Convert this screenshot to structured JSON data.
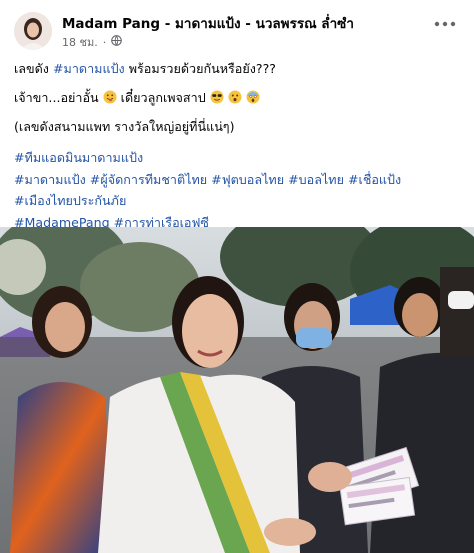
{
  "post": {
    "author": "Madam Pang - มาดามแป้ง - นวลพรรณ ล่ำซำ",
    "time": "18 ชม.",
    "privacy_icon": "globe-icon",
    "more_icon": "more-options-icon",
    "caption": {
      "line1_pre": "เลขดัง ",
      "line1_tag": "#มาดามแป้ง",
      "line1_post": " พร้อมรวยด้วยกันหรือยัง???",
      "line2_text": "เจ้าขา...อย่าอั้น",
      "line2_mid": "เดี๋ยวลูกเพจสาป",
      "line3": "(เลขดังสนามแพท รางวัลใหญ่อยู่ที่นี่แน่ๆ)"
    },
    "hashtags": [
      [
        "#ทีมแอดมินมาดามแป้ง"
      ],
      [
        "#มาดามแป้ง",
        "#ผู้จัดการทีมชาติไทย",
        "#ฟุตบอลไทย",
        "#บอลไทย",
        "#เชื่อแป้ง"
      ],
      [
        "#เมืองไทยประกันภัย"
      ],
      [
        "#MadamePang",
        "#การท่าเรือเอฟซี"
      ]
    ],
    "colors": {
      "link": "#2455a6",
      "meta": "#65676b",
      "text": "#050505"
    }
  }
}
